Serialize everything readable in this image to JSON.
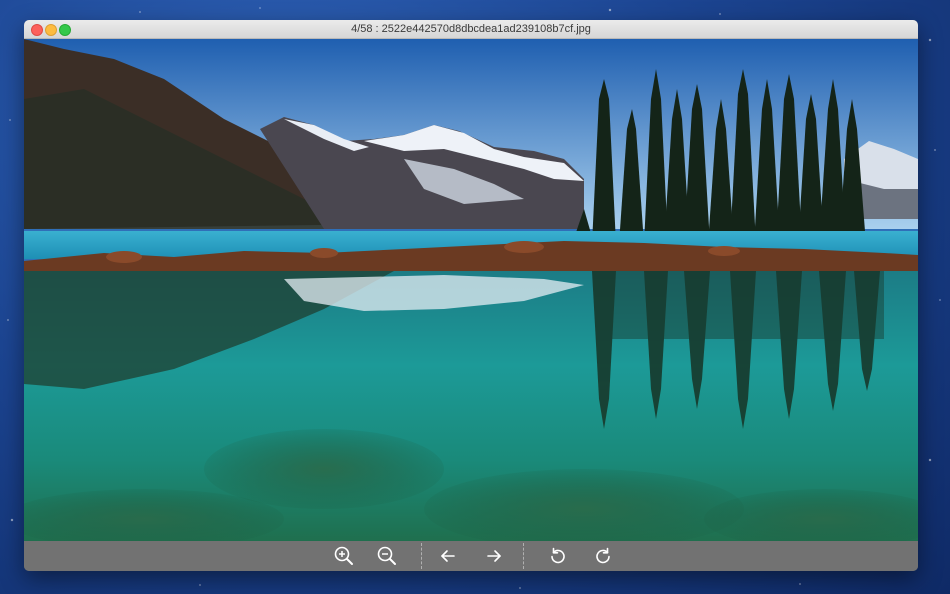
{
  "window": {
    "title": "4/58 : 2522e442570d8dbcdea1ad239108b7cf.jpg"
  },
  "toolbar": {
    "buttons": [
      {
        "name": "zoom-in",
        "icon": "zoom-in-icon"
      },
      {
        "name": "zoom-out",
        "icon": "zoom-out-icon"
      },
      {
        "name": "previous",
        "icon": "arrow-left-icon"
      },
      {
        "name": "next",
        "icon": "arrow-right-icon"
      },
      {
        "name": "rotate-left",
        "icon": "rotate-ccw-icon"
      },
      {
        "name": "rotate-right",
        "icon": "rotate-cw-icon"
      }
    ]
  },
  "colors": {
    "toolbar_bg": "#727272",
    "icon_color": "#ffffff",
    "sky_top": "#1f5fb0",
    "lake": "#1c9a98"
  }
}
